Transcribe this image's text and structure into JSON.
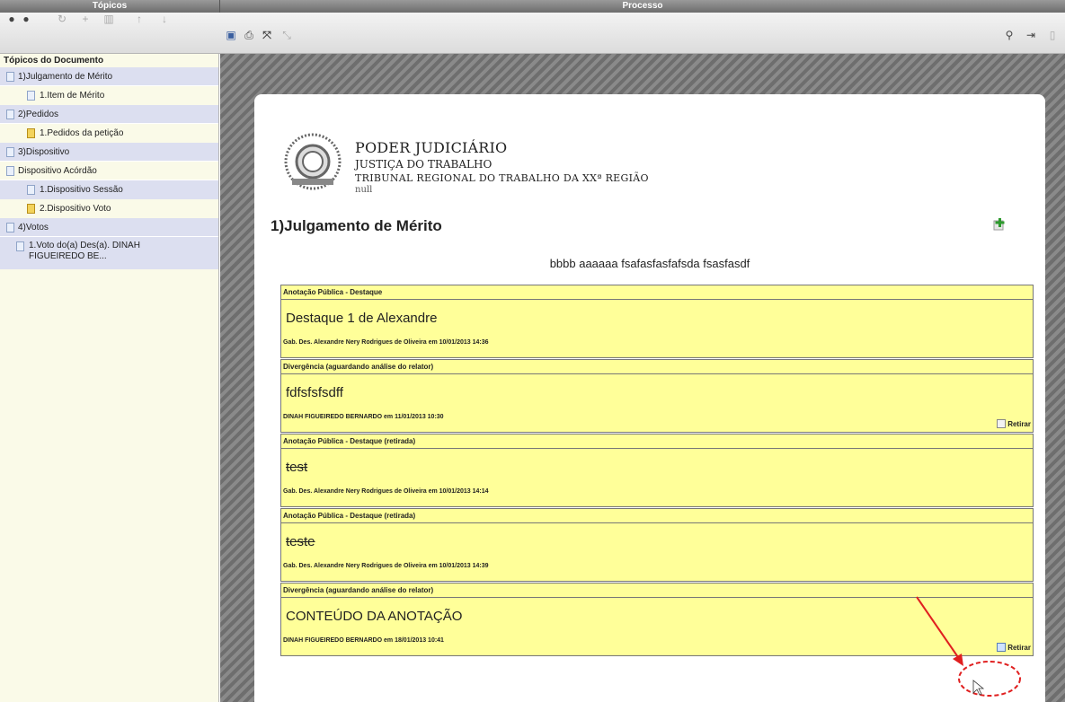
{
  "header": {
    "left_title": "Tópicos",
    "right_title": "Processo"
  },
  "toolbar_left": {
    "icons": [
      "circle-left-icon",
      "circle-right-icon",
      "refresh-icon",
      "add-icon",
      "trash-icon",
      "arrow-up-icon",
      "arrow-down-icon"
    ]
  },
  "toolbar_right": {
    "icons": [
      "save-icon",
      "print-icon",
      "expand-icon",
      "shrink-icon",
      "search-icon",
      "export-icon"
    ]
  },
  "sidebar": {
    "title": "Tópicos do Documento",
    "items": [
      {
        "label": "1)Julgamento de Mérito",
        "level": 0
      },
      {
        "label": "1.Item de Mérito",
        "level": 1
      },
      {
        "label": "2)Pedidos",
        "level": 0
      },
      {
        "label": "1.Pedidos da petição",
        "level": 1
      },
      {
        "label": "3)Dispositivo",
        "level": 0
      },
      {
        "label": "Dispositivo Acórdão",
        "level": 0
      },
      {
        "label": "1.Dispositivo Sessão",
        "level": 1
      },
      {
        "label": "2.Dispositivo Voto",
        "level": 1
      },
      {
        "label": "4)Votos",
        "level": 0
      },
      {
        "label": "1.Voto do(a) Des(a). DINAH FIGUEIREDO BE...",
        "level": 1
      }
    ]
  },
  "document": {
    "letterhead": {
      "line1": "PODER JUDICIÁRIO",
      "line2": "JUSTIÇA DO TRABALHO",
      "line3": "TRIBUNAL REGIONAL DO TRABALHO DA XXª REGIÃO",
      "line4": "null"
    },
    "section_title": "1)Julgamento de Mérito",
    "paragraph": "bbbb aaaaaa fsafasfasfafsda fsasfasdf",
    "annotations": [
      {
        "title": "Anotação Pública - Destaque",
        "body": "Destaque 1 de Alexandre",
        "footer": "Gab. Des. Alexandre Nery Rodrigues de Oliveira em 10/01/2013 14:36",
        "retirar": ""
      },
      {
        "title": "Divergência (aguardando análise do relator)",
        "body": "fdfsfsfsdff",
        "footer": "DINAH FIGUEIREDO BERNARDO em 11/01/2013 10:30",
        "retirar": "Retirar"
      },
      {
        "title": "Anotação Pública - Destaque (retirada)",
        "body": "test",
        "footer": "Gab. Des. Alexandre Nery Rodrigues de Oliveira em 10/01/2013 14:14",
        "retirar": ""
      },
      {
        "title": "Anotação Pública - Destaque (retirada)",
        "body": "teste",
        "footer": "Gab. Des. Alexandre Nery Rodrigues de Oliveira em 10/01/2013 14:39",
        "retirar": ""
      },
      {
        "title": "Divergência (aguardando análise do relator)",
        "body": "CONTEÚDO DA ANOTAÇÃO",
        "footer": "DINAH FIGUEIREDO BERNARDO em 18/01/2013 10:41",
        "retirar": "Retirar"
      }
    ]
  },
  "colors": {
    "annotation_bg": "#ffff99",
    "tree_highlight": "#dcdff0",
    "callout": "#e02020"
  }
}
